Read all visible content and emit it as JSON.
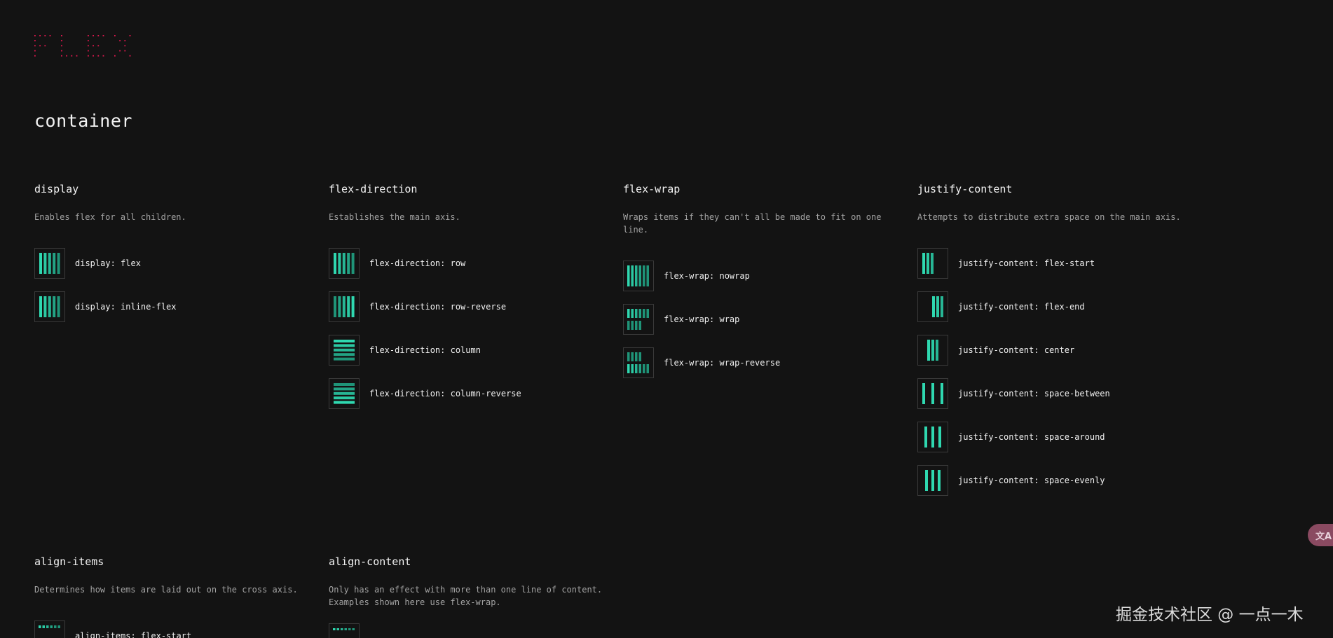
{
  "logo": {
    "alt": "FLEX"
  },
  "section_title": "container",
  "groups": [
    {
      "title": "display",
      "desc": "Enables flex for all children.",
      "items": [
        {
          "label": "display: flex",
          "icon": "display-flex-icon"
        },
        {
          "label": "display: inline-flex",
          "icon": "display-inline-flex-icon"
        }
      ]
    },
    {
      "title": "flex-direction",
      "desc": "Establishes the main axis.",
      "items": [
        {
          "label": "flex-direction: row",
          "icon": "flex-direction-row-icon"
        },
        {
          "label": "flex-direction: row-reverse",
          "icon": "flex-direction-row-reverse-icon"
        },
        {
          "label": "flex-direction: column",
          "icon": "flex-direction-column-icon"
        },
        {
          "label": "flex-direction: column-reverse",
          "icon": "flex-direction-column-reverse-icon"
        }
      ]
    },
    {
      "title": "flex-wrap",
      "desc": "Wraps items if they can't all be made to fit on one line.",
      "items": [
        {
          "label": "flex-wrap: nowrap",
          "icon": "flex-wrap-nowrap-icon"
        },
        {
          "label": "flex-wrap: wrap",
          "icon": "flex-wrap-wrap-icon"
        },
        {
          "label": "flex-wrap: wrap-reverse",
          "icon": "flex-wrap-wrap-reverse-icon"
        }
      ]
    },
    {
      "title": "justify-content",
      "desc": "Attempts to distribute extra space on the main axis.",
      "items": [
        {
          "label": "justify-content: flex-start",
          "icon": "justify-flex-start-icon"
        },
        {
          "label": "justify-content: flex-end",
          "icon": "justify-flex-end-icon"
        },
        {
          "label": "justify-content: center",
          "icon": "justify-center-icon"
        },
        {
          "label": "justify-content: space-between",
          "icon": "justify-space-between-icon"
        },
        {
          "label": "justify-content: space-around",
          "icon": "justify-space-around-icon"
        },
        {
          "label": "justify-content: space-evenly",
          "icon": "justify-space-evenly-icon"
        }
      ]
    },
    {
      "title": "align-items",
      "desc": "Determines how items are laid out on the cross axis.",
      "items": [
        {
          "label": "align-items: flex-start",
          "icon": "align-items-flex-start-icon"
        }
      ]
    },
    {
      "title": "align-content",
      "desc": "Only has an effect with more than one line of content.\nExamples shown here use flex-wrap.",
      "items": [
        {
          "label": "",
          "icon": "align-content-icon"
        }
      ]
    }
  ],
  "fab": {
    "icon": "translate-icon",
    "glyph": "文A"
  },
  "watermark": "掘金技术社区 @ 一点一木",
  "colors": {
    "background": "#131313",
    "accent": "#2fd8b0",
    "accent_dim": "#1f9478",
    "logo": "#e1174f",
    "thumb_border": "#3a3a3a"
  }
}
